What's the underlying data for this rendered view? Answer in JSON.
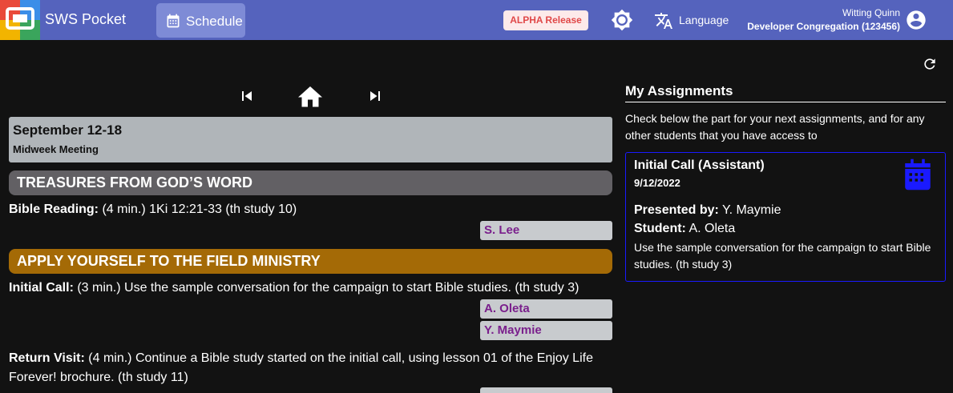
{
  "header": {
    "app_title": "SWS Pocket",
    "schedule_label": "Schedule",
    "release_badge": "ALPHA Release",
    "language_label": "Language",
    "user_name": "Witting Quinn",
    "congregation": "Developer Congregation (123456)",
    "bar_color": "#5563bd"
  },
  "week": {
    "title": "September 12-18",
    "subtitle": "Midweek Meeting"
  },
  "sections": {
    "treasures": "TREASURES FROM GOD’S WORD",
    "apply": "APPLY YOURSELF TO THE FIELD MINISTRY"
  },
  "parts": {
    "bible_reading": {
      "name": "Bible Reading:",
      "detail": " (4 min.) 1Ki 12:21-33 (th study 10)",
      "assignee": "S. Lee"
    },
    "initial_call": {
      "name": "Initial Call:",
      "detail": " (3 min.) Use the sample conversation for the campaign to start Bible studies. (th study 3)",
      "student": "A. Oleta",
      "assistant": "Y. Maymie"
    },
    "return_visit": {
      "name": "Return Visit:",
      "detail": " (4 min.) Continue a Bible study started on the initial call, using lesson 01 of the Enjoy Life Forever! brochure. (th study 11)"
    }
  },
  "my_assignments": {
    "title": "My Assignments",
    "description": "Check below the part for your next assignments, and for any other students that you have access to",
    "card": {
      "title": "Initial Call (Assistant)",
      "date": "9/12/2022",
      "presented_by_label": "Presented by:",
      "presented_by": " Y. Maymie",
      "student_label": "Student:",
      "student": " A. Oleta",
      "description": "Use the sample conversation for the campaign to start Bible studies. (th study 3)"
    }
  },
  "icons": {
    "logo": "app-logo-icon",
    "schedule": "calendar-icon",
    "theme": "brightness-icon",
    "language": "translate-icon",
    "user": "account-circle-icon",
    "first": "skip-first-icon",
    "home": "home-icon",
    "last": "skip-last-icon",
    "refresh": "refresh-icon",
    "card": "calendar-month-icon"
  }
}
